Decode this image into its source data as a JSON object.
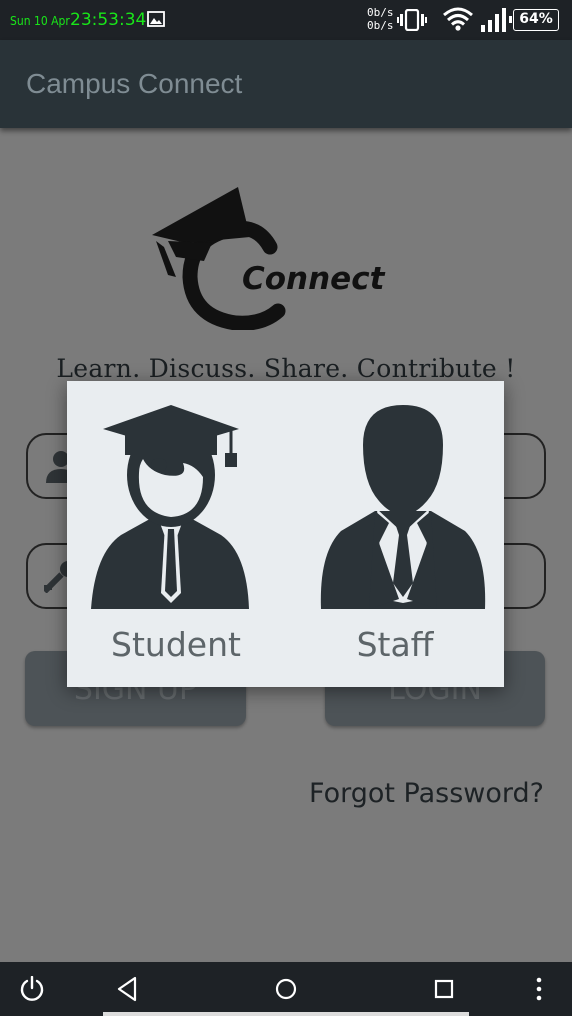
{
  "status_bar": {
    "date": "Sun 10 Apr",
    "time": "23:53:34",
    "net_up": "0b/s",
    "net_down": "0b/s",
    "battery": "64%",
    "icons": [
      "gallery-icon",
      "vibrate-icon",
      "wifi-icon",
      "signal-icon",
      "battery-icon"
    ]
  },
  "app_bar": {
    "title": "Campus Connect"
  },
  "logo": {
    "text": "Connect"
  },
  "tagline": "Learn. Discuss. Share. Contribute !",
  "form": {
    "username_icon": "user-icon",
    "password_icon": "key-icon",
    "signup_label": "SIGN UP",
    "login_label": "LOGIN",
    "forgot_label": "Forgot Password?"
  },
  "dialog": {
    "options": [
      {
        "label": "Student",
        "icon": "student-icon"
      },
      {
        "label": "Staff",
        "icon": "staff-icon"
      }
    ]
  },
  "nav_bar": {
    "icons": [
      "power-icon",
      "back-icon",
      "home-icon",
      "recents-icon",
      "more-icon"
    ]
  },
  "colors": {
    "app_bar": "#293338",
    "dialog_bg": "#e9edf0",
    "icon_dark": "#2b3338",
    "status_time": "#19e619"
  }
}
